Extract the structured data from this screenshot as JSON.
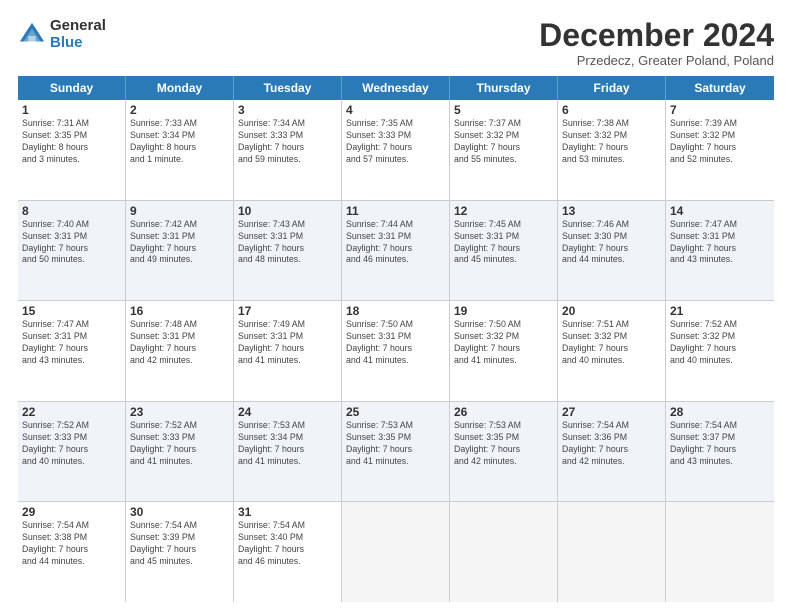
{
  "logo": {
    "general": "General",
    "blue": "Blue"
  },
  "header": {
    "month": "December 2024",
    "location": "Przedecz, Greater Poland, Poland"
  },
  "days": [
    "Sunday",
    "Monday",
    "Tuesday",
    "Wednesday",
    "Thursday",
    "Friday",
    "Saturday"
  ],
  "weeks": [
    [
      {
        "day": "1",
        "lines": [
          "Sunrise: 7:31 AM",
          "Sunset: 3:35 PM",
          "Daylight: 8 hours",
          "and 3 minutes."
        ]
      },
      {
        "day": "2",
        "lines": [
          "Sunrise: 7:33 AM",
          "Sunset: 3:34 PM",
          "Daylight: 8 hours",
          "and 1 minute."
        ]
      },
      {
        "day": "3",
        "lines": [
          "Sunrise: 7:34 AM",
          "Sunset: 3:33 PM",
          "Daylight: 7 hours",
          "and 59 minutes."
        ]
      },
      {
        "day": "4",
        "lines": [
          "Sunrise: 7:35 AM",
          "Sunset: 3:33 PM",
          "Daylight: 7 hours",
          "and 57 minutes."
        ]
      },
      {
        "day": "5",
        "lines": [
          "Sunrise: 7:37 AM",
          "Sunset: 3:32 PM",
          "Daylight: 7 hours",
          "and 55 minutes."
        ]
      },
      {
        "day": "6",
        "lines": [
          "Sunrise: 7:38 AM",
          "Sunset: 3:32 PM",
          "Daylight: 7 hours",
          "and 53 minutes."
        ]
      },
      {
        "day": "7",
        "lines": [
          "Sunrise: 7:39 AM",
          "Sunset: 3:32 PM",
          "Daylight: 7 hours",
          "and 52 minutes."
        ]
      }
    ],
    [
      {
        "day": "8",
        "lines": [
          "Sunrise: 7:40 AM",
          "Sunset: 3:31 PM",
          "Daylight: 7 hours",
          "and 50 minutes."
        ]
      },
      {
        "day": "9",
        "lines": [
          "Sunrise: 7:42 AM",
          "Sunset: 3:31 PM",
          "Daylight: 7 hours",
          "and 49 minutes."
        ]
      },
      {
        "day": "10",
        "lines": [
          "Sunrise: 7:43 AM",
          "Sunset: 3:31 PM",
          "Daylight: 7 hours",
          "and 48 minutes."
        ]
      },
      {
        "day": "11",
        "lines": [
          "Sunrise: 7:44 AM",
          "Sunset: 3:31 PM",
          "Daylight: 7 hours",
          "and 46 minutes."
        ]
      },
      {
        "day": "12",
        "lines": [
          "Sunrise: 7:45 AM",
          "Sunset: 3:31 PM",
          "Daylight: 7 hours",
          "and 45 minutes."
        ]
      },
      {
        "day": "13",
        "lines": [
          "Sunrise: 7:46 AM",
          "Sunset: 3:30 PM",
          "Daylight: 7 hours",
          "and 44 minutes."
        ]
      },
      {
        "day": "14",
        "lines": [
          "Sunrise: 7:47 AM",
          "Sunset: 3:31 PM",
          "Daylight: 7 hours",
          "and 43 minutes."
        ]
      }
    ],
    [
      {
        "day": "15",
        "lines": [
          "Sunrise: 7:47 AM",
          "Sunset: 3:31 PM",
          "Daylight: 7 hours",
          "and 43 minutes."
        ]
      },
      {
        "day": "16",
        "lines": [
          "Sunrise: 7:48 AM",
          "Sunset: 3:31 PM",
          "Daylight: 7 hours",
          "and 42 minutes."
        ]
      },
      {
        "day": "17",
        "lines": [
          "Sunrise: 7:49 AM",
          "Sunset: 3:31 PM",
          "Daylight: 7 hours",
          "and 41 minutes."
        ]
      },
      {
        "day": "18",
        "lines": [
          "Sunrise: 7:50 AM",
          "Sunset: 3:31 PM",
          "Daylight: 7 hours",
          "and 41 minutes."
        ]
      },
      {
        "day": "19",
        "lines": [
          "Sunrise: 7:50 AM",
          "Sunset: 3:32 PM",
          "Daylight: 7 hours",
          "and 41 minutes."
        ]
      },
      {
        "day": "20",
        "lines": [
          "Sunrise: 7:51 AM",
          "Sunset: 3:32 PM",
          "Daylight: 7 hours",
          "and 40 minutes."
        ]
      },
      {
        "day": "21",
        "lines": [
          "Sunrise: 7:52 AM",
          "Sunset: 3:32 PM",
          "Daylight: 7 hours",
          "and 40 minutes."
        ]
      }
    ],
    [
      {
        "day": "22",
        "lines": [
          "Sunrise: 7:52 AM",
          "Sunset: 3:33 PM",
          "Daylight: 7 hours",
          "and 40 minutes."
        ]
      },
      {
        "day": "23",
        "lines": [
          "Sunrise: 7:52 AM",
          "Sunset: 3:33 PM",
          "Daylight: 7 hours",
          "and 41 minutes."
        ]
      },
      {
        "day": "24",
        "lines": [
          "Sunrise: 7:53 AM",
          "Sunset: 3:34 PM",
          "Daylight: 7 hours",
          "and 41 minutes."
        ]
      },
      {
        "day": "25",
        "lines": [
          "Sunrise: 7:53 AM",
          "Sunset: 3:35 PM",
          "Daylight: 7 hours",
          "and 41 minutes."
        ]
      },
      {
        "day": "26",
        "lines": [
          "Sunrise: 7:53 AM",
          "Sunset: 3:35 PM",
          "Daylight: 7 hours",
          "and 42 minutes."
        ]
      },
      {
        "day": "27",
        "lines": [
          "Sunrise: 7:54 AM",
          "Sunset: 3:36 PM",
          "Daylight: 7 hours",
          "and 42 minutes."
        ]
      },
      {
        "day": "28",
        "lines": [
          "Sunrise: 7:54 AM",
          "Sunset: 3:37 PM",
          "Daylight: 7 hours",
          "and 43 minutes."
        ]
      }
    ],
    [
      {
        "day": "29",
        "lines": [
          "Sunrise: 7:54 AM",
          "Sunset: 3:38 PM",
          "Daylight: 7 hours",
          "and 44 minutes."
        ]
      },
      {
        "day": "30",
        "lines": [
          "Sunrise: 7:54 AM",
          "Sunset: 3:39 PM",
          "Daylight: 7 hours",
          "and 45 minutes."
        ]
      },
      {
        "day": "31",
        "lines": [
          "Sunrise: 7:54 AM",
          "Sunset: 3:40 PM",
          "Daylight: 7 hours",
          "and 46 minutes."
        ]
      },
      {
        "day": "",
        "lines": []
      },
      {
        "day": "",
        "lines": []
      },
      {
        "day": "",
        "lines": []
      },
      {
        "day": "",
        "lines": []
      }
    ]
  ]
}
